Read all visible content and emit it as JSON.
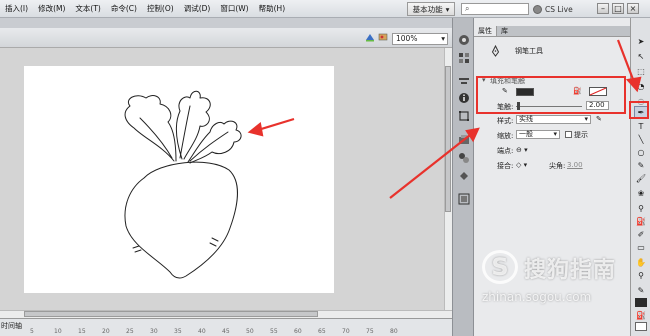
{
  "menu": [
    "插入(I)",
    "修改(M)",
    "文本(T)",
    "命令(C)",
    "控制(O)",
    "调试(D)",
    "窗口(W)",
    "帮助(H)"
  ],
  "workspace_label": "基本功能",
  "search_placeholder": "",
  "cs_live_label": "CS Live",
  "window_buttons": [
    "–",
    "□",
    "×"
  ],
  "stage": {
    "zoom_value": "100%"
  },
  "timeline": {
    "label": "时间轴",
    "ticks": [
      "5",
      "10",
      "15",
      "20",
      "25",
      "30",
      "35",
      "40",
      "45",
      "50",
      "55",
      "60",
      "65",
      "70",
      "75",
      "80"
    ]
  },
  "properties": {
    "tabs": [
      "属性",
      "库"
    ],
    "tool_name": "钢笔工具",
    "section_title": "填充和笔触",
    "stroke_value": "2.00",
    "stroke_label": "笔触:",
    "style_label": "样式:",
    "style_value": "实线",
    "scale_label": "缩放:",
    "scale_value": "一般",
    "hint_label": "提示",
    "cap_label": "端点:",
    "join_label": "接合:",
    "miter_label": "尖角:",
    "miter_value": "3.00"
  },
  "watermark": {
    "line1": "搜狗指南",
    "line2": "zhinan.sogou.com",
    "logo_letter": "S"
  },
  "colors": {
    "accent": "#e8322c",
    "stroke_swatch": "#2b2b2b",
    "fill_swatch": "#ffffff"
  }
}
